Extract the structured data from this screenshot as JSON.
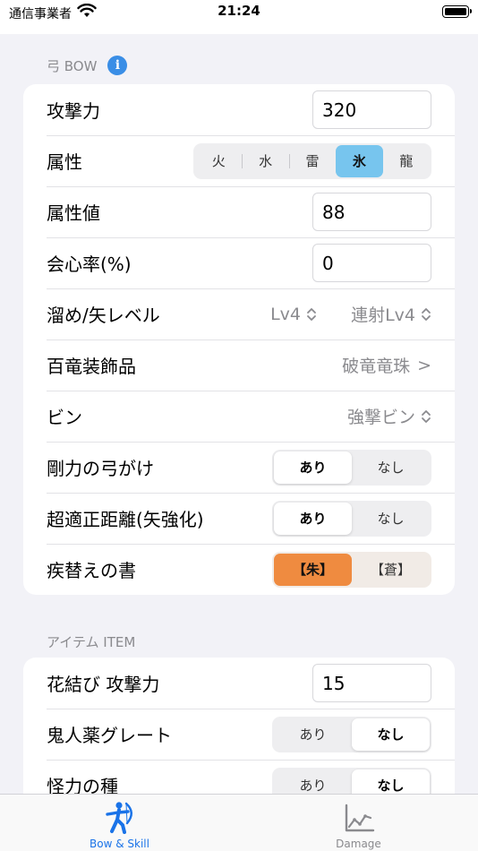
{
  "status_bar": {
    "carrier": "通信事業者",
    "time": "21:24"
  },
  "colors": {
    "accent": "#1a73e8",
    "info": "#3a8ee6",
    "element_selected": "#77c5ee",
    "orange_selected": "#ef8b40",
    "background": "#f2f2f7"
  },
  "bow_section": {
    "header": "弓 BOW",
    "info_glyph": "i",
    "attack": {
      "label": "攻撃力",
      "value": "320"
    },
    "element": {
      "label": "属性",
      "options": [
        "火",
        "水",
        "雷",
        "氷",
        "龍"
      ],
      "selected": "氷"
    },
    "element_value": {
      "label": "属性値",
      "value": "88"
    },
    "affinity": {
      "label": "会心率(%)",
      "value": "0"
    },
    "charge_level": {
      "label": "溜め/矢レベル",
      "charge": "Lv4",
      "arrow": "連射Lv4"
    },
    "decoration": {
      "label": "百竜装飾品",
      "value": "破竜竜珠",
      "chevron": ">"
    },
    "coating": {
      "label": "ビン",
      "value": "強撃ビン"
    },
    "bow_charge_plus": {
      "label": "剛力の弓がけ",
      "options": [
        "あり",
        "なし"
      ],
      "selected": "あり"
    },
    "sweet_spot": {
      "label": "超適正距離(矢強化)",
      "options": [
        "あり",
        "なし"
      ],
      "selected": "あり"
    },
    "switch_scroll": {
      "label": "疾替えの書",
      "options": [
        "【朱】",
        "【蒼】"
      ],
      "selected": "【朱】"
    }
  },
  "item_section": {
    "header": "アイテム ITEM",
    "flower_attack": {
      "label": "花結び 攻撃力",
      "value": "15"
    },
    "demondrug": {
      "label": "鬼人薬グレート",
      "options": [
        "あり",
        "なし"
      ],
      "selected": "なし"
    },
    "might_seed": {
      "label": "怪力の種",
      "options": [
        "あり",
        "なし"
      ],
      "selected": "なし"
    }
  },
  "tab_bar": {
    "tabs": [
      {
        "label": "Bow & Skill",
        "icon": "archer-icon",
        "active": true
      },
      {
        "label": "Damage",
        "icon": "line-chart-icon",
        "active": false
      }
    ]
  }
}
